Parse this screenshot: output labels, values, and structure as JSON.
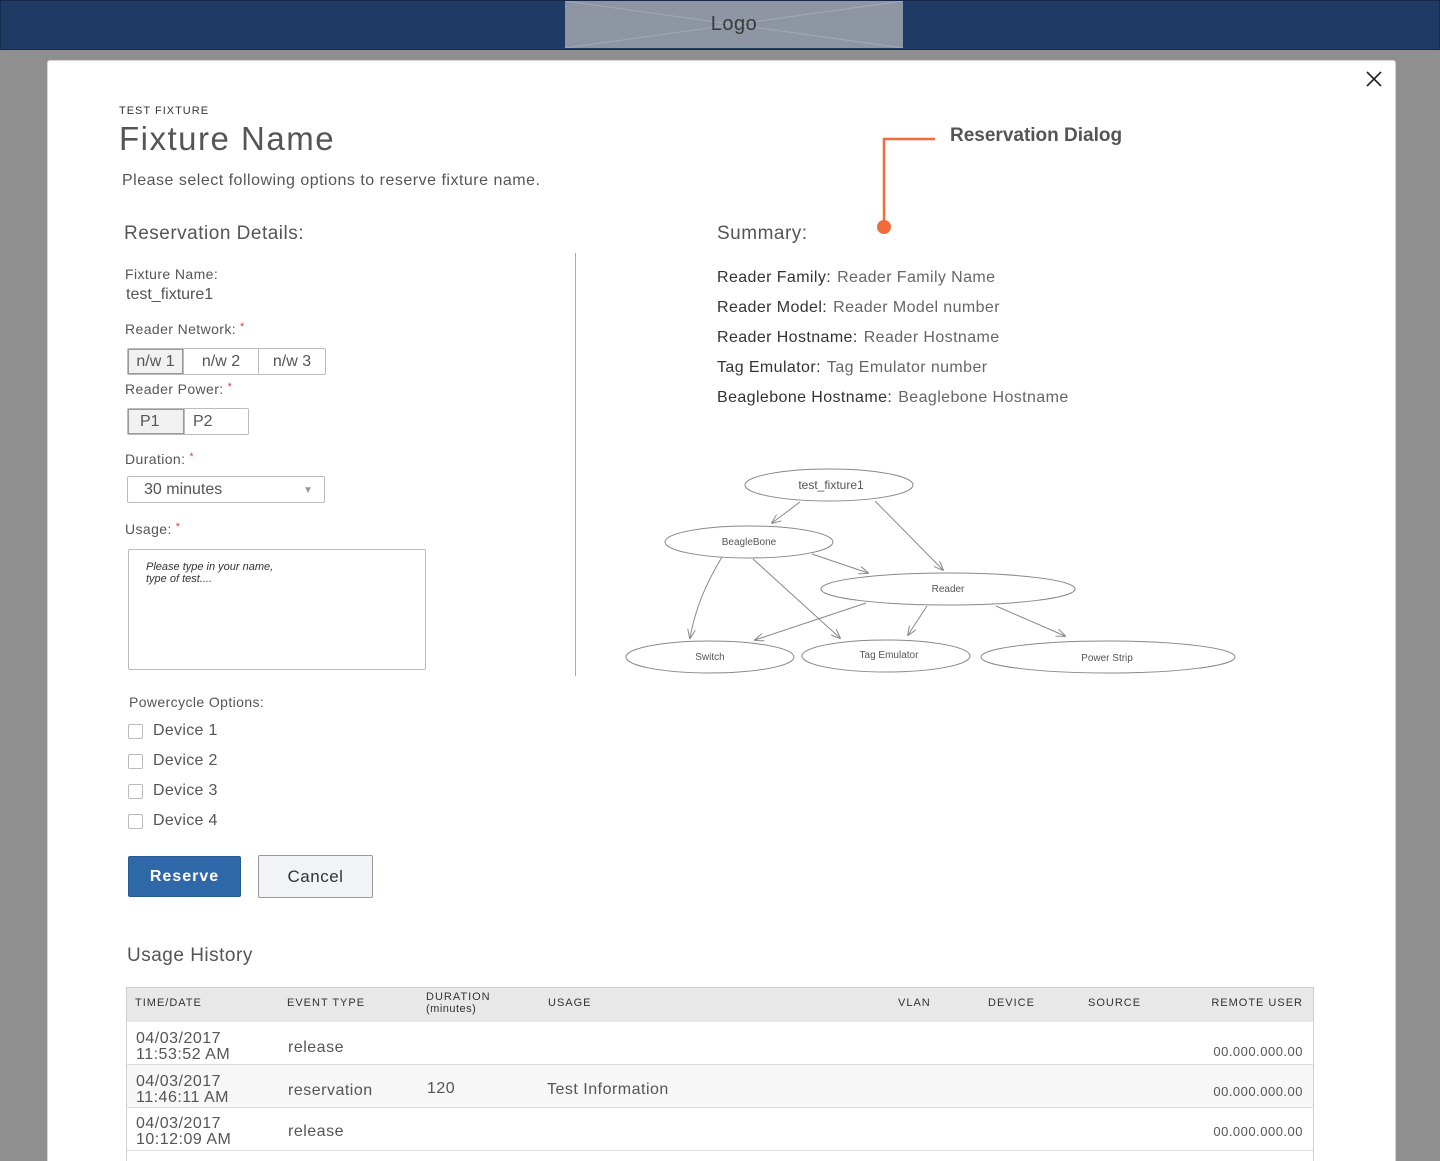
{
  "header": {
    "logo_label": "Logo"
  },
  "dialog": {
    "eyebrow": "TEST FIXTURE",
    "title": "Fixture Name",
    "subtitle": "Please select following options to reserve fixture name.",
    "annotation": "Reservation Dialog",
    "close_icon": "close-icon"
  },
  "details": {
    "heading": "Reservation Details:",
    "fixture_name_label": "Fixture Name:",
    "fixture_name_value": "test_fixture1",
    "network_label": "Reader Network:",
    "networks": [
      "n/w 1",
      "n/w 2",
      "n/w 3"
    ],
    "network_selected": "n/w 1",
    "power_label": "Reader Power:",
    "powers": [
      "P1",
      "P2"
    ],
    "power_selected": "P1",
    "duration_label": "Duration:",
    "duration_value": "30 minutes",
    "usage_label": "Usage:",
    "usage_placeholder": "Please type in your name,\ntype of test....",
    "required_marker": "*",
    "powercycle_label": "Powercycle Options:",
    "devices": [
      "Device 1",
      "Device 2",
      "Device 3",
      "Device 4"
    ],
    "reserve_label": "Reserve",
    "cancel_label": "Cancel"
  },
  "summary": {
    "heading": "Summary:",
    "rows": [
      {
        "key": "Reader Family:",
        "value": "Reader Family Name"
      },
      {
        "key": "Reader Model:",
        "value": "Reader Model number"
      },
      {
        "key": "Reader Hostname:",
        "value": "Reader Hostname"
      },
      {
        "key": "Tag Emulator:",
        "value": "Tag Emulator number"
      },
      {
        "key": "Beaglebone Hostname:",
        "value": "Beaglebone Hostname"
      }
    ],
    "graph_nodes": [
      "test_fixture1",
      "BeagleBone",
      "Reader",
      "Switch",
      "Tag Emulator",
      "Power Strip"
    ]
  },
  "history": {
    "heading": "Usage History",
    "columns": [
      "TIME/DATE",
      "EVENT TYPE",
      "DURATION",
      "(minutes)",
      "USAGE",
      "VLAN",
      "DEVICE",
      "SOURCE",
      "REMOTE USER"
    ],
    "rows": [
      {
        "date": "04/03/2017",
        "time": "11:53:52 AM",
        "event": "release",
        "duration": "",
        "usage": "",
        "remote_user": "00.000.000.00"
      },
      {
        "date": "04/03/2017",
        "time": "11:46:11 AM",
        "event": "reservation",
        "duration": "120",
        "usage": "Test Information",
        "remote_user": "00.000.000.00"
      },
      {
        "date": "04/03/2017",
        "time": "10:12:09 AM",
        "event": "release",
        "duration": "",
        "usage": "",
        "remote_user": "00.000.000.00"
      }
    ]
  },
  "colors": {
    "header_bg": "#1f3a64",
    "primary_button": "#2e68a9",
    "required": "#e0403c",
    "annotation": "#f26b3a"
  }
}
